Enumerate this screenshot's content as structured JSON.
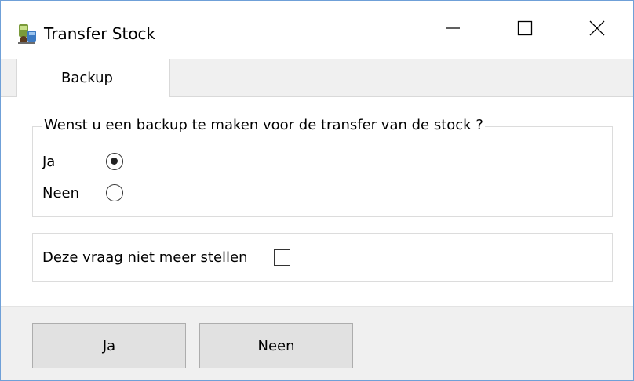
{
  "window": {
    "title": "Transfer Stock",
    "border_color": "#6fa0d8"
  },
  "titlebar_buttons": {
    "minimize_icon": "minimize-icon",
    "maximize_icon": "maximize-icon",
    "close_icon": "close-icon"
  },
  "tabs": [
    {
      "label": "Backup",
      "selected": true
    }
  ],
  "backup_group": {
    "legend": "Wenst u een backup te maken voor de transfer van de stock ?",
    "options": [
      {
        "label": "Ja",
        "checked": true
      },
      {
        "label": "Neen",
        "checked": false
      }
    ]
  },
  "dont_ask": {
    "label": "Deze vraag niet meer stellen",
    "checked": false
  },
  "buttons": {
    "yes_label": "Ja",
    "no_label": "Neen"
  }
}
